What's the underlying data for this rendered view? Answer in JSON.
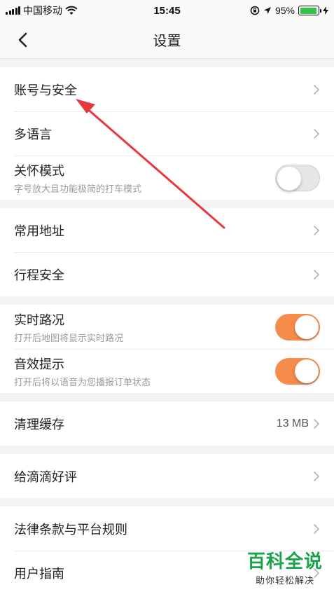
{
  "status_bar": {
    "carrier": "中国移动",
    "time": "15:45",
    "battery_percent": "95%",
    "battery_level": 0.95
  },
  "header": {
    "title": "设置"
  },
  "groups": [
    {
      "items": [
        {
          "title": "账号与安全"
        },
        {
          "title": "多语言"
        },
        {
          "title": "关怀模式",
          "subtitle": "字号放大且功能极简的打车模式",
          "toggle": false
        }
      ]
    },
    {
      "items": [
        {
          "title": "常用地址"
        },
        {
          "title": "行程安全"
        }
      ]
    },
    {
      "items": [
        {
          "title": "实时路况",
          "subtitle": "打开后地图将显示实时路况",
          "toggle": true
        },
        {
          "title": "音效提示",
          "subtitle": "打开后将以语音为您播报订单状态",
          "toggle": true
        }
      ]
    },
    {
      "items": [
        {
          "title": "清理缓存",
          "value": "13 MB"
        }
      ]
    },
    {
      "items": [
        {
          "title": "给滴滴好评"
        }
      ]
    },
    {
      "items": [
        {
          "title": "法律条款与平台规则"
        },
        {
          "title": "用户指南"
        }
      ]
    }
  ],
  "watermark": {
    "main": "百科全说",
    "sub": "助你轻松解决"
  },
  "colors": {
    "toggle_on": "#f58c4b",
    "annotation_arrow": "#e8383d",
    "watermark": "#1aa34a"
  }
}
